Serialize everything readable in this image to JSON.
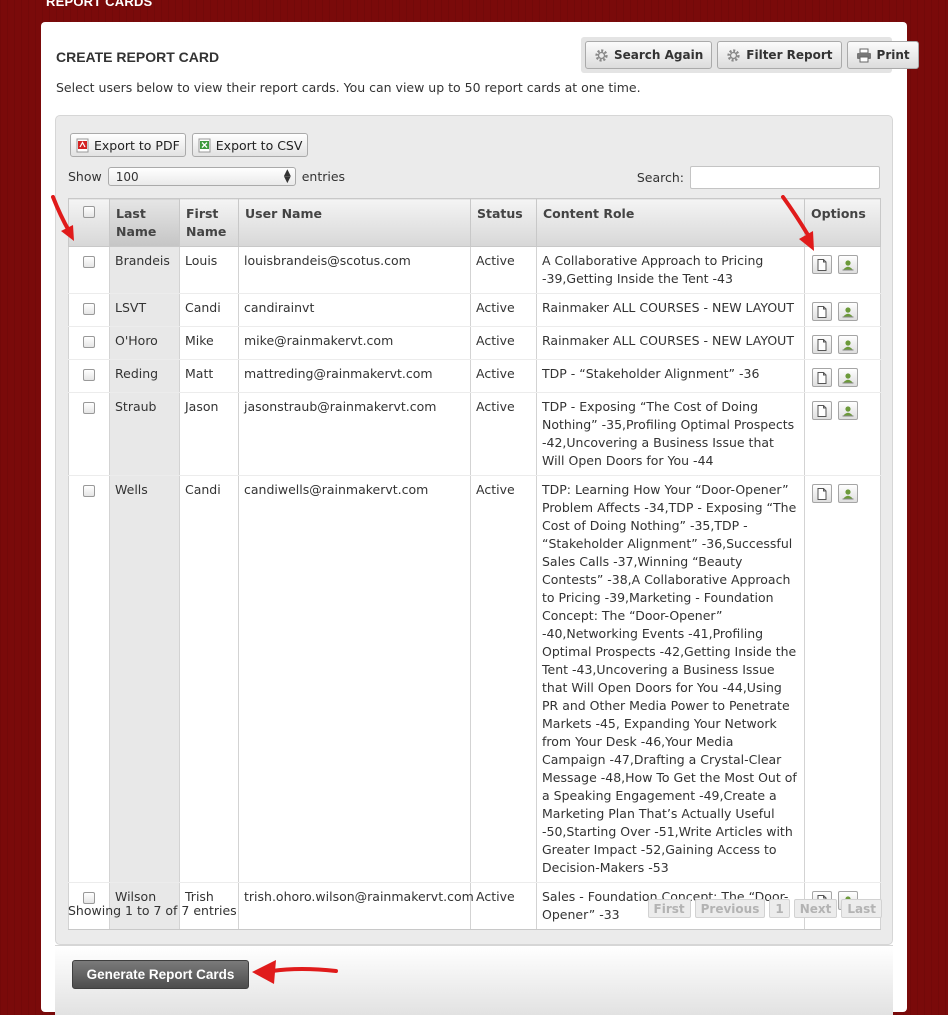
{
  "page": {
    "heading": "REPORT CARDS"
  },
  "card": {
    "title": "CREATE REPORT CARD",
    "description": "Select users below to view their report cards. You can view up to 50 report cards at one time."
  },
  "top_actions": {
    "search_again": "Search Again",
    "filter_report": "Filter Report",
    "print": "Print"
  },
  "export": {
    "pdf": "Export to PDF",
    "csv": "Export to CSV"
  },
  "length": {
    "show_label": "Show",
    "selected": "100",
    "entries_label": "entries"
  },
  "search": {
    "label": "Search:",
    "value": ""
  },
  "table": {
    "headers": {
      "last_name": "Last Name",
      "first_name": "First Name",
      "user_name": "User Name",
      "status": "Status",
      "content_role": "Content Role",
      "options": "Options"
    },
    "rows": [
      {
        "last": "Brandeis",
        "first": "Louis",
        "user": "louisbrandeis@scotus.com",
        "status": "Active",
        "role": "A Collaborative Approach to Pricing -39,Getting Inside the Tent -43"
      },
      {
        "last": "LSVT",
        "first": "Candi",
        "user": "candirainvt",
        "status": "Active",
        "role": "Rainmaker ALL COURSES - NEW LAYOUT"
      },
      {
        "last": "O'Horo",
        "first": "Mike",
        "user": "mike@rainmakervt.com",
        "status": "Active",
        "role": "Rainmaker ALL COURSES - NEW LAYOUT"
      },
      {
        "last": "Reding",
        "first": "Matt",
        "user": "mattreding@rainmakervt.com",
        "status": "Active",
        "role": "TDP - “Stakeholder Alignment” -36"
      },
      {
        "last": "Straub",
        "first": "Jason",
        "user": "jasonstraub@rainmakervt.com",
        "status": "Active",
        "role": "TDP - Exposing “The Cost of Doing Nothing” -35,Profiling Optimal Prospects -42,Uncovering a Business Issue that Will Open Doors for You -44"
      },
      {
        "last": "Wells",
        "first": "Candi",
        "user": "candiwells@rainmakervt.com",
        "status": "Active",
        "role": "TDP: Learning How Your “Door-Opener” Problem Affects -34,TDP - Exposing “The Cost of Doing Nothing” -35,TDP - “Stakeholder Alignment” -36,Successful Sales Calls -37,Winning “Beauty Contests” -38,A Collaborative Approach to Pricing -39,Marketing - Foundation Concept: The “Door-Opener” -40,Networking Events -41,Profiling Optimal Prospects -42,Getting Inside the Tent -43,Uncovering a Business Issue that Will Open Doors for You -44,Using PR and Other Media Power to Penetrate Markets -45, Expanding Your Network from Your Desk -46,Your Media Campaign -47,Drafting a Crystal-Clear Message -48,How To Get the Most Out of a Speaking Engagement -49,Create a Marketing Plan That’s Actually Useful -50,Starting Over -51,Write Articles with Greater Impact -52,Gaining Access to Decision-Makers -53"
      },
      {
        "last": "Wilson",
        "first": "Trish",
        "user": "trish.ohoro.wilson@rainmakervt.com",
        "status": "Active",
        "role": "Sales - Foundation Concept: The “Door-Opener” -33"
      }
    ]
  },
  "info": "Showing 1 to 7 of 7 entries",
  "pager": {
    "first": "First",
    "previous": "Previous",
    "page": "1",
    "next": "Next",
    "last": "Last"
  },
  "footer": {
    "generate": "Generate Report Cards"
  },
  "icons": {
    "search_again": "gear-icon",
    "filter_report": "gear-icon",
    "print": "printer-icon",
    "export_pdf": "pdf-icon",
    "export_csv": "csv-icon",
    "row_view": "document-icon",
    "row_user": "user-icon",
    "annotation": "red-arrow-icon"
  },
  "colors": {
    "background": "#7a0a0a",
    "arrow": "#e01b1b",
    "generate_button": "#5a5a5a"
  }
}
